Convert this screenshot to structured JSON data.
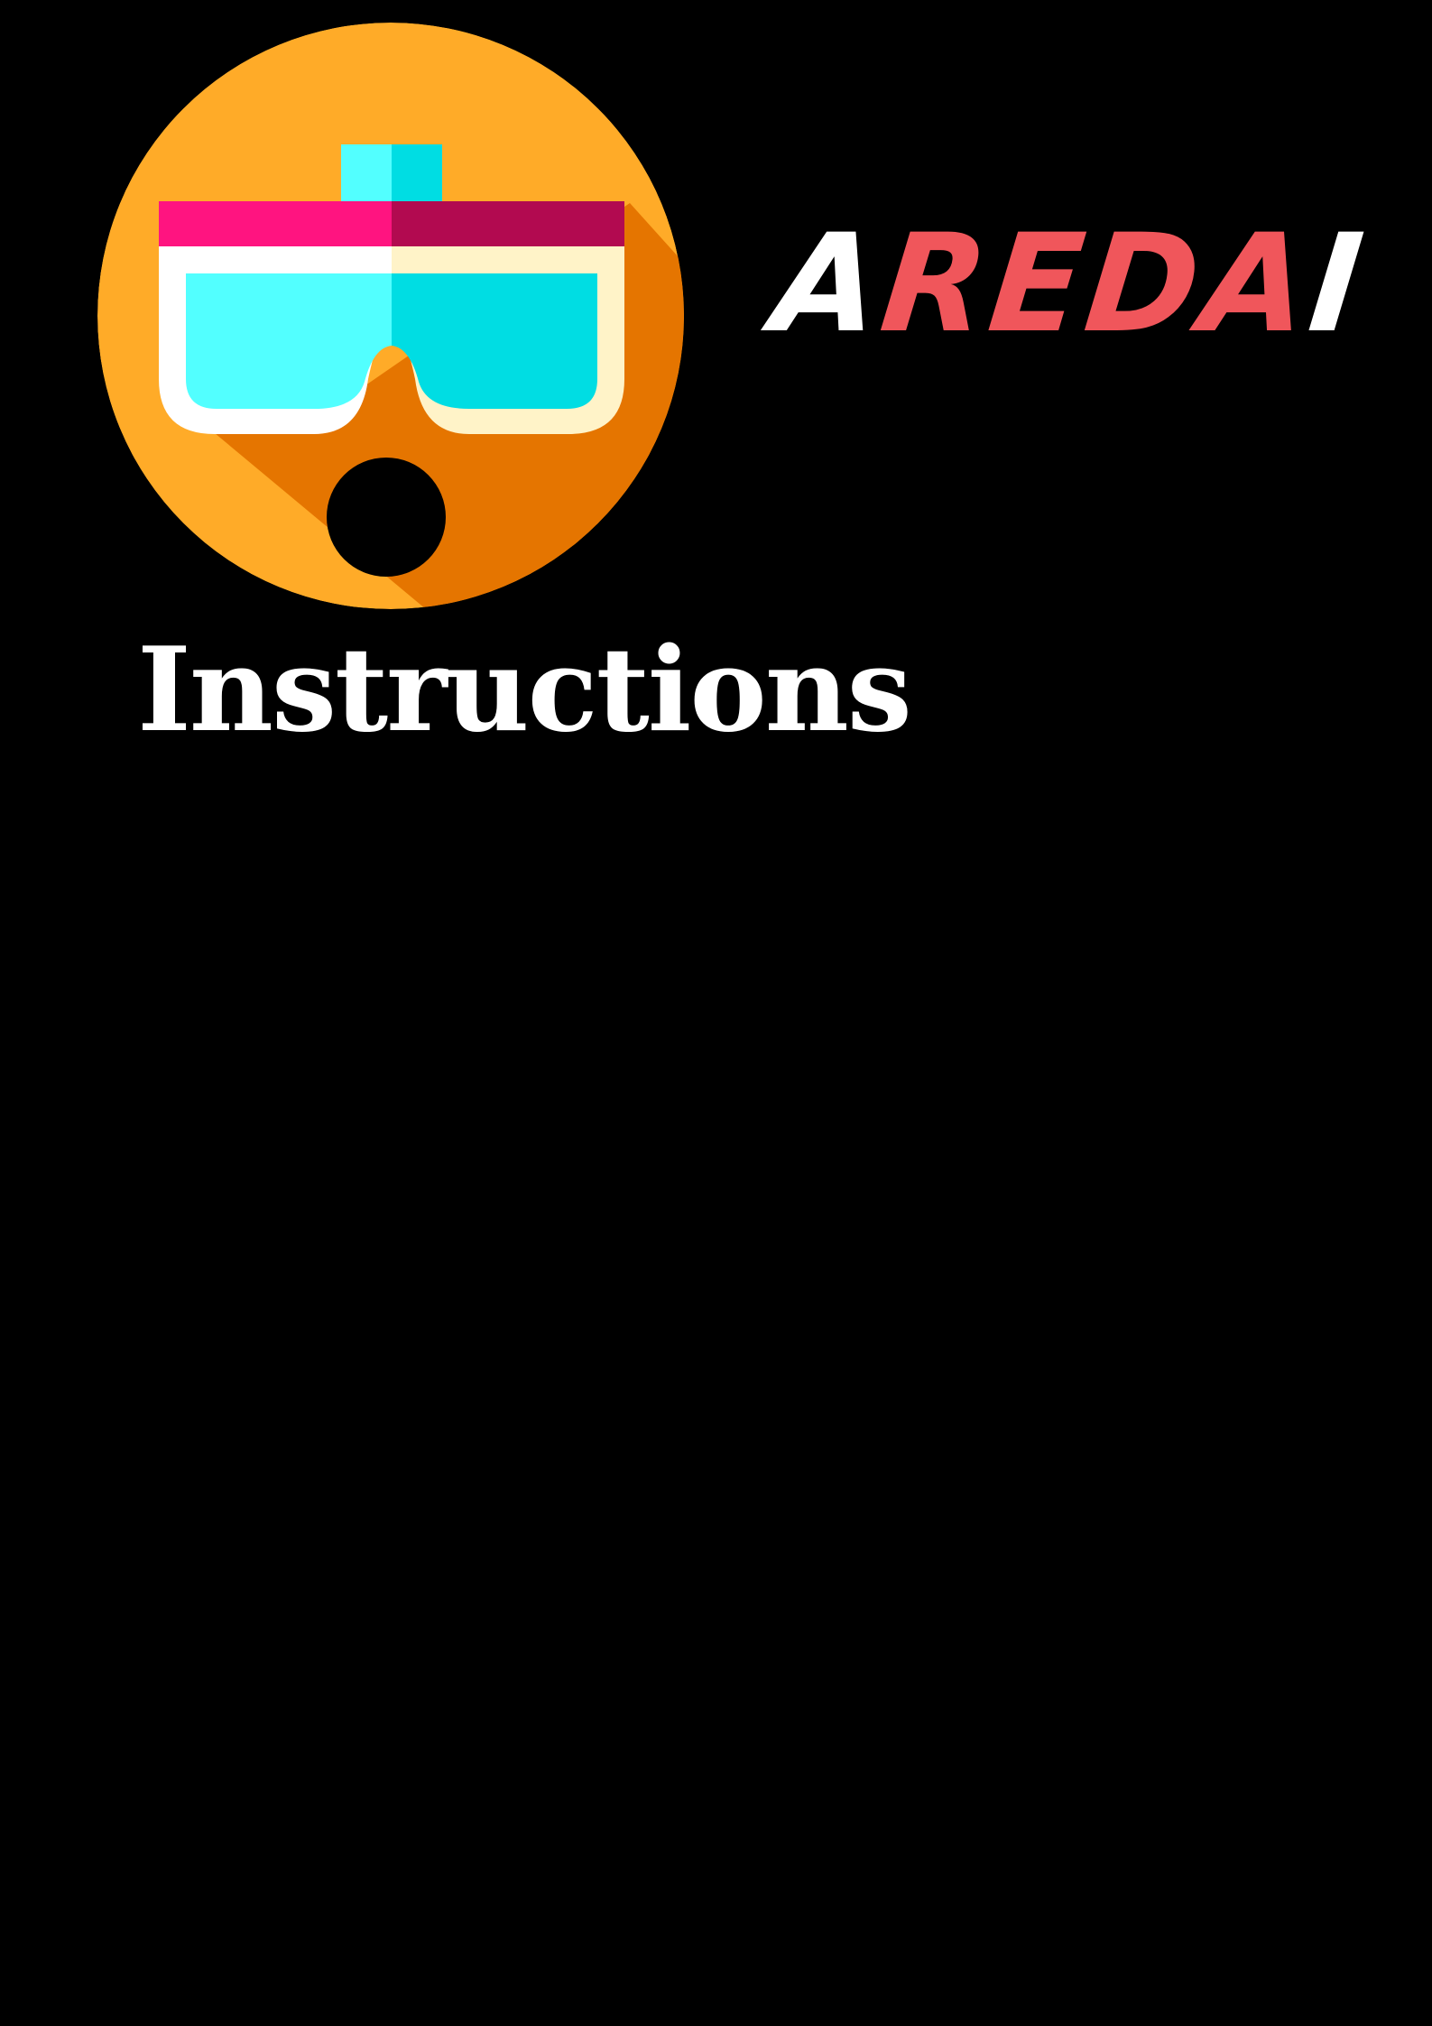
{
  "brand": {
    "name": "AREDAI",
    "part_a": "A",
    "part_red": "REDA",
    "part_i": "I",
    "colors": {
      "light": "#ffffff",
      "accent": "#f0565b"
    }
  },
  "logo": {
    "icon": "vr-goggles-surprised-face-icon",
    "colors": {
      "circle": "#ffab28",
      "shadow": "#e57500",
      "strap_left": "#ff1480",
      "strap_right": "#b20a50",
      "lens_left": "#52ffff",
      "lens_right": "#00dde3",
      "frame_left": "#ffffff",
      "frame_right": "#fff3c8",
      "mouth": "#000000"
    }
  },
  "heading": {
    "text": "Instructions"
  },
  "background": "#000000"
}
